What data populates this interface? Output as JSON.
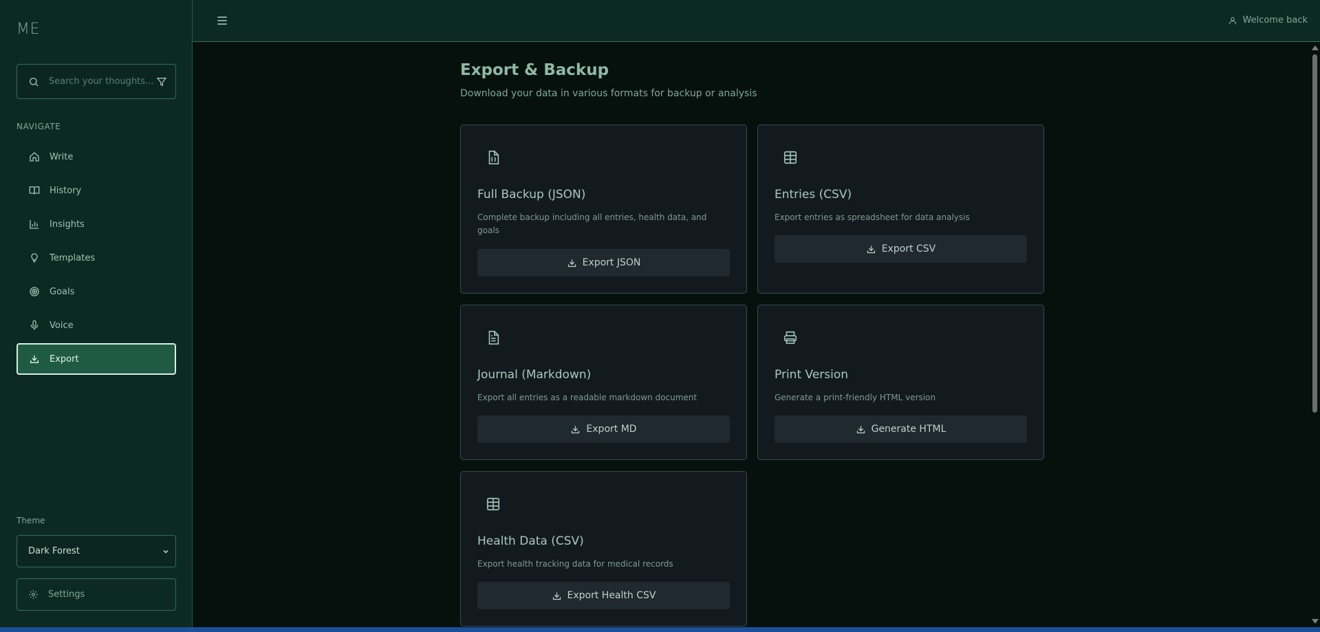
{
  "app": {
    "logo": "ME"
  },
  "sidebar": {
    "search": {
      "placeholder": "Search your thoughts..."
    },
    "nav_heading": "NAVIGATE",
    "items": [
      {
        "label": "Write",
        "icon": "home-icon"
      },
      {
        "label": "History",
        "icon": "book-icon"
      },
      {
        "label": "Insights",
        "icon": "bar-chart-icon"
      },
      {
        "label": "Templates",
        "icon": "lightbulb-icon"
      },
      {
        "label": "Goals",
        "icon": "target-icon"
      },
      {
        "label": "Voice",
        "icon": "microphone-icon"
      },
      {
        "label": "Export",
        "icon": "download-icon",
        "active": true
      }
    ],
    "theme": {
      "label": "Theme",
      "selected": "Dark Forest"
    },
    "settings_label": "Settings"
  },
  "header": {
    "welcome": "Welcome back"
  },
  "main": {
    "title": "Export & Backup",
    "subtitle": "Download your data in various formats for backup or analysis",
    "cards": [
      {
        "title": "Full Backup (JSON)",
        "description": "Complete backup including all entries, health data, and goals",
        "button": "Export JSON",
        "icon": "file-json-icon"
      },
      {
        "title": "Entries (CSV)",
        "description": "Export entries as spreadsheet for data analysis",
        "button": "Export CSV",
        "icon": "table-icon"
      },
      {
        "title": "Journal (Markdown)",
        "description": "Export all entries as a readable markdown document",
        "button": "Export MD",
        "icon": "file-text-icon"
      },
      {
        "title": "Print Version",
        "description": "Generate a print-friendly HTML version",
        "button": "Generate HTML",
        "icon": "printer-icon"
      },
      {
        "title": "Health Data (CSV)",
        "description": "Export health tracking data for medical records",
        "button": "Export Health CSV",
        "icon": "table-icon"
      }
    ]
  },
  "colors": {
    "accent": "#1f5a45",
    "sidebar_bg": "#0d2a22",
    "page_bg": "#06110e",
    "card_bg": "#121a20"
  }
}
